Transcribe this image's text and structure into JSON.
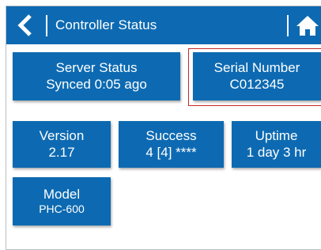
{
  "header": {
    "title": "Controller Status",
    "back_icon": "chevron-left-icon",
    "home_icon": "home-icon",
    "bg_color": "#0d6ab2"
  },
  "tiles": {
    "server_status": {
      "label": "Server Status",
      "value": "Synced 0:05 ago"
    },
    "serial_number": {
      "label": "Serial Number",
      "value": "C012345"
    },
    "version": {
      "label": "Version",
      "value": "2.17"
    },
    "success": {
      "label": "Success",
      "value": "4 [4] ****"
    },
    "uptime": {
      "label": "Uptime",
      "value": "1 day 3 hr"
    },
    "model": {
      "label": "Model",
      "value": "PHC-600"
    }
  },
  "highlight_color": "#c62828"
}
